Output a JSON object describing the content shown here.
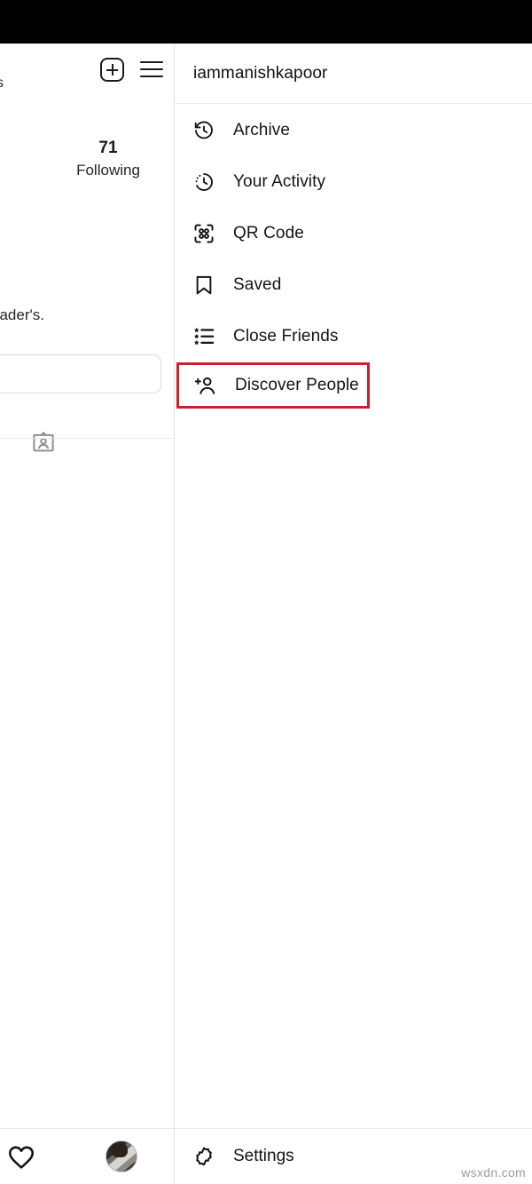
{
  "app": {
    "platform": "instagram-mobile-web",
    "watermark": "wsxdn.com"
  },
  "status_bar": {
    "color": "#000000"
  },
  "left_panel": {
    "header": {
      "new_post_icon": "plus-box-icon",
      "menu_icon": "hamburger-icon"
    },
    "stats": {
      "clipped_followers_label": "s",
      "following_count": "71",
      "following_label": "Following"
    },
    "bio_clipped": "eader's.",
    "edit_profile_button_label": "",
    "badge_icon": "name-badge-icon",
    "bottom_nav": {
      "activity_icon": "heart-icon",
      "profile_avatar": "avatar"
    }
  },
  "menu_panel": {
    "username": "iammanishkapoor",
    "items": [
      {
        "label": "Archive",
        "icon": "archive-clock-icon",
        "highlighted": false
      },
      {
        "label": "Your Activity",
        "icon": "activity-clock-icon",
        "highlighted": false
      },
      {
        "label": "QR Code",
        "icon": "qr-code-icon",
        "highlighted": false
      },
      {
        "label": "Saved",
        "icon": "bookmark-icon",
        "highlighted": false
      },
      {
        "label": "Close Friends",
        "icon": "star-list-icon",
        "highlighted": false
      },
      {
        "label": "Discover People",
        "icon": "add-person-icon",
        "highlighted": true
      }
    ],
    "footer": {
      "settings_label": "Settings",
      "settings_icon": "gear-icon"
    }
  },
  "colors": {
    "highlight_border": "#c8202f",
    "text_primary": "#141414",
    "divider": "#ececec",
    "status_bar": "#000000"
  }
}
